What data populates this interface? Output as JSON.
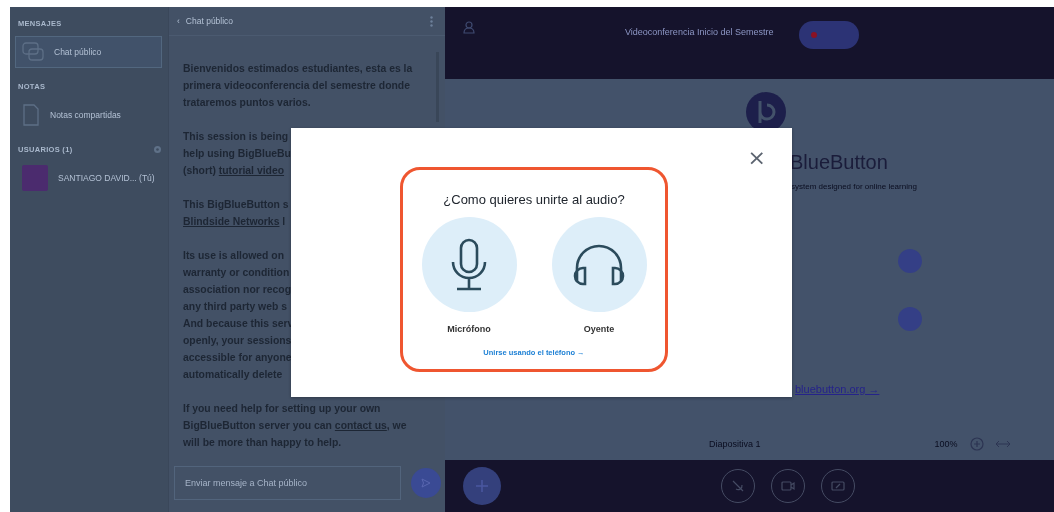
{
  "sidebar": {
    "sections": [
      {
        "title": "MENSAJES",
        "kind": "plain",
        "items": [
          {
            "label": "Chat público",
            "kind": "chat",
            "selected": true
          }
        ]
      },
      {
        "title": "NOTAS",
        "kind": "plain",
        "items": [
          {
            "label": "Notas compartidas",
            "kind": "notes",
            "selected": false
          }
        ]
      },
      {
        "title": "USUARIOS (1)",
        "kind": "settings",
        "items": [
          {
            "label": "SANTIAGO DAVID... (Tú)",
            "kind": "user",
            "selected": false
          }
        ]
      }
    ]
  },
  "chat": {
    "title": "Chat público",
    "back": "‹",
    "messages": [
      [
        [
          {
            "text": "Bienvenidos estimados estudiantes, esta es la"
          }
        ],
        [
          {
            "text": "primera videoconferencia del semestre donde"
          }
        ],
        [
          {
            "text": "trataremos puntos varios."
          }
        ]
      ],
      [
        [
          {
            "text": "This session is being"
          }
        ],
        [
          {
            "text": "help using BigBlueBu"
          }
        ],
        [
          {
            "text": "(short) "
          },
          {
            "text": "tutorial video",
            "link": true
          }
        ]
      ],
      [
        [
          {
            "text": "This BigBlueButton s"
          }
        ],
        [
          {
            "text": "Blindside Networks",
            "link": true
          },
          {
            "text": " l"
          }
        ]
      ],
      [
        [
          {
            "text": "Its use is allowed on"
          }
        ],
        [
          {
            "text": "warranty or condition"
          }
        ],
        [
          {
            "text": "association nor recog"
          }
        ],
        [
          {
            "text": "any third party web s"
          }
        ],
        [
          {
            "text": "And because this serv"
          }
        ],
        [
          {
            "text": "openly, your sessions"
          }
        ],
        [
          {
            "text": "accessible for anyone"
          }
        ],
        [
          {
            "text": "automatically delete"
          }
        ]
      ],
      [
        [
          {
            "text": "If you need help for setting up your own"
          }
        ],
        [
          {
            "text": "BigBlueButton server you can "
          },
          {
            "text": "contact us",
            "link": true
          },
          {
            "text": ", we"
          }
        ],
        [
          {
            "text": "will be more than happy to help."
          }
        ]
      ]
    ],
    "placeholder": "Enviar mensaje a Chat público"
  },
  "topbar": {
    "title": "Videoconferencia Inicio del Semestre",
    "recording": true
  },
  "slide": {
    "title": "BlueButton",
    "subtitle": "system designed for online learning",
    "features": [
      {
        "kind": "icon"
      },
      {
        "kind": "icon"
      }
    ],
    "link": "bluebutton.org →",
    "page": "Diapositiva 1",
    "zoom": "100%"
  },
  "modal": {
    "title": "¿Como quieres unirte al audio?",
    "options": [
      {
        "label": "Micrófono",
        "kind": "microphone"
      },
      {
        "label": "Oyente",
        "kind": "listen"
      }
    ],
    "phone_link": "Unirse usando el teléfono →",
    "close": "×"
  }
}
